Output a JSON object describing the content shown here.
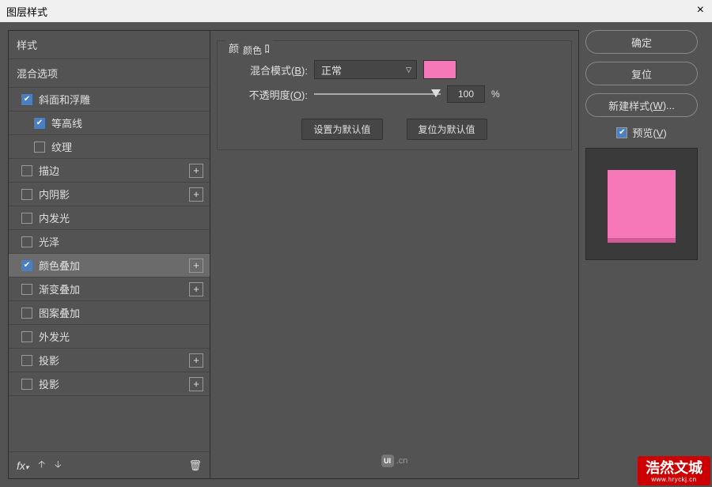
{
  "window": {
    "title": "图层样式",
    "close": "×"
  },
  "sidebar": {
    "styles_header": "样式",
    "blend_header": "混合选项",
    "items": [
      {
        "label": "斜面和浮雕",
        "checked": true,
        "indent": 1,
        "add": false
      },
      {
        "label": "等高线",
        "checked": true,
        "indent": 2,
        "add": false
      },
      {
        "label": "纹理",
        "checked": false,
        "indent": 2,
        "add": false
      },
      {
        "label": "描边",
        "checked": false,
        "indent": 1,
        "add": true
      },
      {
        "label": "内阴影",
        "checked": false,
        "indent": 1,
        "add": true
      },
      {
        "label": "内发光",
        "checked": false,
        "indent": 1,
        "add": false
      },
      {
        "label": "光泽",
        "checked": false,
        "indent": 1,
        "add": false
      },
      {
        "label": "颜色叠加",
        "checked": true,
        "indent": 1,
        "add": true,
        "selected": true
      },
      {
        "label": "渐变叠加",
        "checked": false,
        "indent": 1,
        "add": true
      },
      {
        "label": "图案叠加",
        "checked": false,
        "indent": 1,
        "add": false
      },
      {
        "label": "外发光",
        "checked": false,
        "indent": 1,
        "add": false
      },
      {
        "label": "投影",
        "checked": false,
        "indent": 1,
        "add": true
      },
      {
        "label": "投影",
        "checked": false,
        "indent": 1,
        "add": true
      }
    ],
    "footer": {
      "fx": "fx",
      "fx_caret": "▾",
      "up": "🡡",
      "down": "🡣",
      "trash": "🗑"
    }
  },
  "center": {
    "group_title": "颜色叠加",
    "inner_title": "颜色",
    "blend_mode_label": "混合模式(B):",
    "blend_mode_value": "正常",
    "opacity_label": "不透明度(O):",
    "opacity_value": "100",
    "opacity_unit": "%",
    "set_default": "设置为默认值",
    "reset_default": "复位为默认值",
    "overlay_color": "#f778b9"
  },
  "right": {
    "ok": "确定",
    "cancel": "复位",
    "new_style": "新建样式(W)...",
    "preview_label": "预览(V)"
  },
  "watermark": {
    "text": "浩然文城",
    "url": "www.hryckj.cn"
  },
  "uilogo": {
    "badge": "UI",
    "text": ".cn"
  }
}
